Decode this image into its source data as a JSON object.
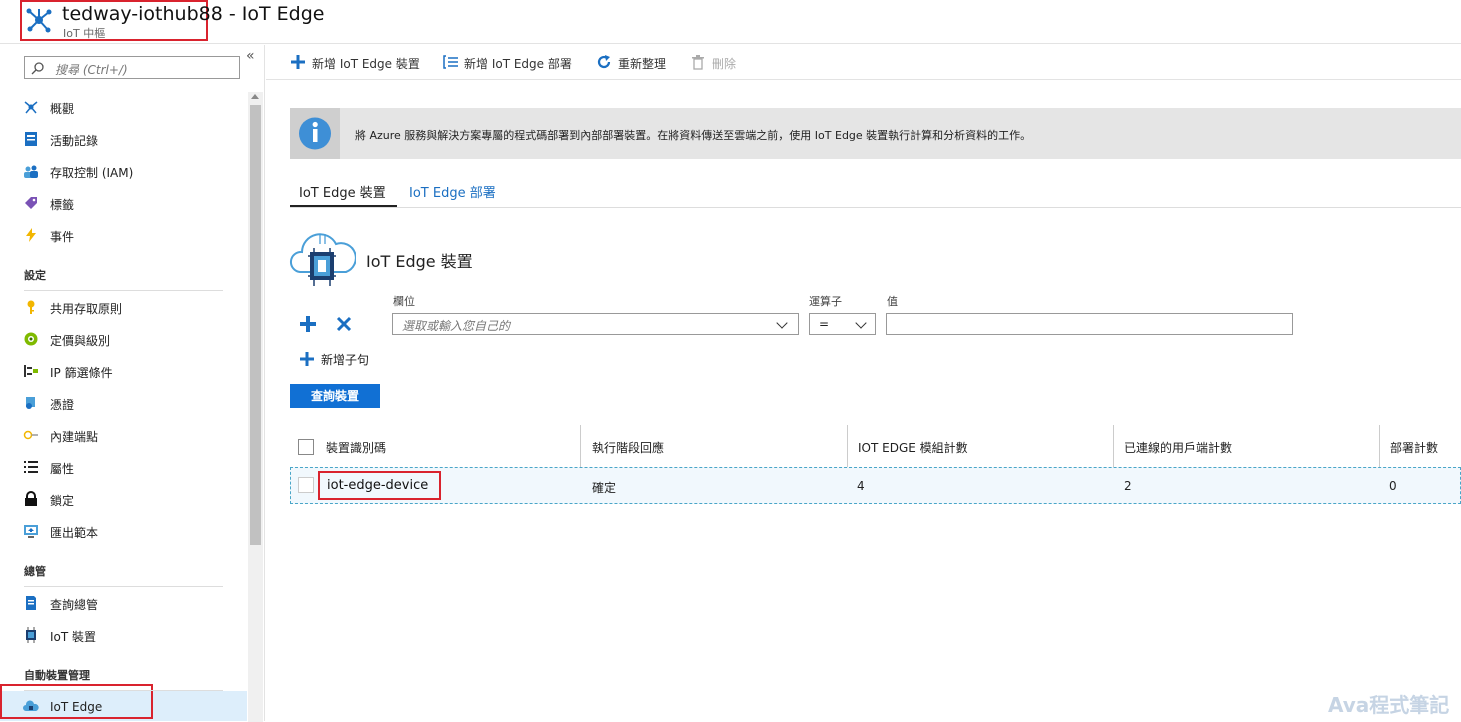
{
  "header": {
    "title": "tedway-iothub88 - IoT Edge",
    "subtitle": "IoT 中樞"
  },
  "sidebar": {
    "collapse_label": "«",
    "search_placeholder": "搜尋 (Ctrl+/)",
    "items": [
      {
        "label": "概觀",
        "icon": "overview-icon"
      },
      {
        "label": "活動記錄",
        "icon": "activity-log-icon"
      },
      {
        "label": "存取控制 (IAM)",
        "icon": "iam-icon"
      },
      {
        "label": "標籤",
        "icon": "tag-icon"
      },
      {
        "label": "事件",
        "icon": "lightning-icon"
      }
    ],
    "sections": [
      {
        "title": "設定",
        "items": [
          {
            "label": "共用存取原則",
            "icon": "key-icon"
          },
          {
            "label": "定價與級別",
            "icon": "pricing-icon"
          },
          {
            "label": "IP 篩選條件",
            "icon": "ip-filter-icon"
          },
          {
            "label": "憑證",
            "icon": "certificate-icon"
          },
          {
            "label": "內建端點",
            "icon": "endpoint-icon"
          },
          {
            "label": "屬性",
            "icon": "properties-icon"
          },
          {
            "label": "鎖定",
            "icon": "lock-icon"
          },
          {
            "label": "匯出範本",
            "icon": "export-template-icon"
          }
        ]
      },
      {
        "title": "總管",
        "items": [
          {
            "label": "查詢總管",
            "icon": "query-explorer-icon"
          },
          {
            "label": "IoT 裝置",
            "icon": "iot-device-icon"
          }
        ]
      },
      {
        "title": "自動裝置管理",
        "items": [
          {
            "label": "IoT Edge",
            "icon": "iot-edge-icon",
            "active": true
          }
        ]
      }
    ]
  },
  "toolbar": {
    "add_device": "新增 IoT Edge 裝置",
    "add_deployment": "新增 IoT Edge 部署",
    "refresh": "重新整理",
    "delete": "刪除"
  },
  "info": {
    "text": "將 Azure 服務與解決方案專屬的程式碼部署到內部部署裝置。在將資料傳送至雲端之前，使用 IoT Edge 裝置執行計算和分析資料的工作。"
  },
  "tabs": [
    {
      "label": "IoT Edge 裝置",
      "active": true
    },
    {
      "label": "IoT Edge 部署",
      "active": false
    }
  ],
  "section_title": "IoT Edge 裝置",
  "filter": {
    "field_label": "欄位",
    "field_placeholder": "選取或輸入您自己的",
    "operator_label": "運算子",
    "operator_value": "=",
    "value_label": "值",
    "value": "",
    "add_clause": "新增子句",
    "query_button": "查詢裝置"
  },
  "table": {
    "columns": [
      "裝置識別碼",
      "執行階段回應",
      "IOT EDGE 模組計數",
      "已連線的用戶端計數",
      "部署計數"
    ],
    "rows": [
      {
        "device_id": "iot-edge-device",
        "runtime_response": "確定",
        "module_count": "4",
        "client_count": "2",
        "deployment_count": "0"
      }
    ]
  },
  "watermark": "Ava程式筆記",
  "colors": {
    "accent": "#1170d4",
    "highlight_border": "#d9232e",
    "active_nav_bg": "#ddeefb",
    "link": "#1b6fc2"
  }
}
